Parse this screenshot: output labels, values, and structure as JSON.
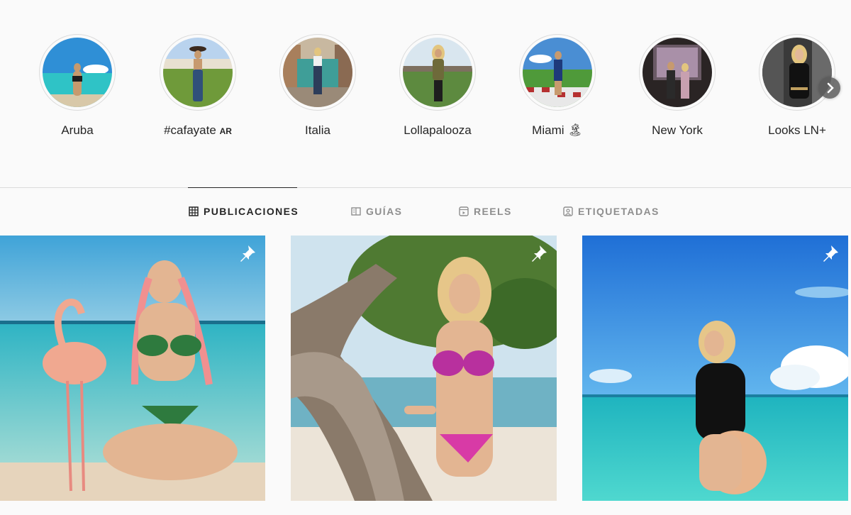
{
  "highlights": [
    {
      "label": "Aruba",
      "icon": "highlight-aruba"
    },
    {
      "label": "#cafayate",
      "badge": "AR",
      "icon": "highlight-cafayate"
    },
    {
      "label": "Italia",
      "icon": "highlight-italia"
    },
    {
      "label": "Lollapalooza",
      "icon": "highlight-lollapalooza"
    },
    {
      "label": "Miami 🏝",
      "icon": "highlight-miami"
    },
    {
      "label": "New York",
      "icon": "highlight-new-york"
    },
    {
      "label": "Looks LN+",
      "icon": "highlight-looks"
    }
  ],
  "tabs": [
    {
      "label": "PUBLICACIONES",
      "icon": "grid-icon",
      "active": true
    },
    {
      "label": "GUÍAS",
      "icon": "guide-icon",
      "active": false
    },
    {
      "label": "REELS",
      "icon": "reels-icon",
      "active": false
    },
    {
      "label": "ETIQUETADAS",
      "icon": "tagged-icon",
      "active": false
    }
  ],
  "posts": [
    {
      "icon": "pin-icon",
      "scene": "woman with flamingo on beach"
    },
    {
      "icon": "pin-icon",
      "scene": "woman by divi tree on beach"
    },
    {
      "icon": "pin-icon",
      "scene": "woman in turquoise sea"
    }
  ],
  "colors": {
    "text": "#262626",
    "muted": "#8e8e8e",
    "border": "#dbdbdb",
    "background": "#fafafa"
  }
}
